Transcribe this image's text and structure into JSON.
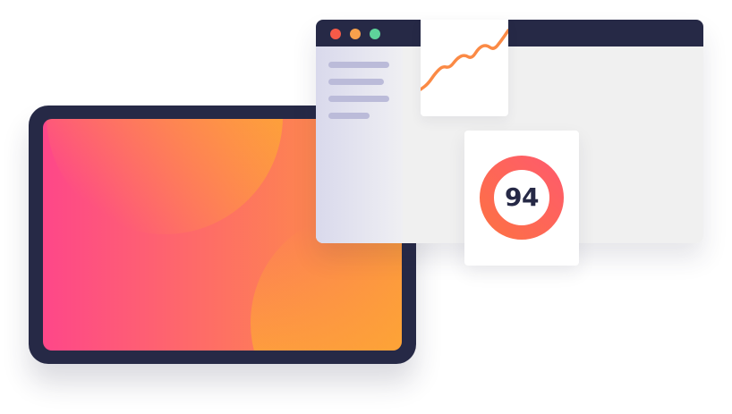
{
  "colors": {
    "frame": "#262946",
    "tablet_gradient_start": "#fe4789",
    "tablet_gradient_end": "#fd9a3d",
    "blob_light": "#fdb22c",
    "sidebar_light": "#d9d9ec",
    "sidebar_fade": "#efeff3",
    "sidebar_line": "#bbbbd9",
    "content_bg": "#f0f0f0",
    "dot_red": "#f55a48",
    "dot_orange": "#f7a14c",
    "dot_green": "#5ed39a",
    "line_orange": "#fb8a45",
    "ring_start": "#fd7046",
    "ring_end": "#fe5c6a",
    "score_text": "#262946"
  },
  "browser": {
    "dots": [
      "dot_red",
      "dot_orange",
      "dot_green"
    ],
    "sidebar_lines": 4
  },
  "trend_chart": {
    "values": [
      12,
      18,
      30,
      38,
      36,
      47,
      51,
      46,
      59,
      62,
      56,
      66,
      78
    ]
  },
  "score": {
    "value": "94",
    "fraction": 1.0
  }
}
